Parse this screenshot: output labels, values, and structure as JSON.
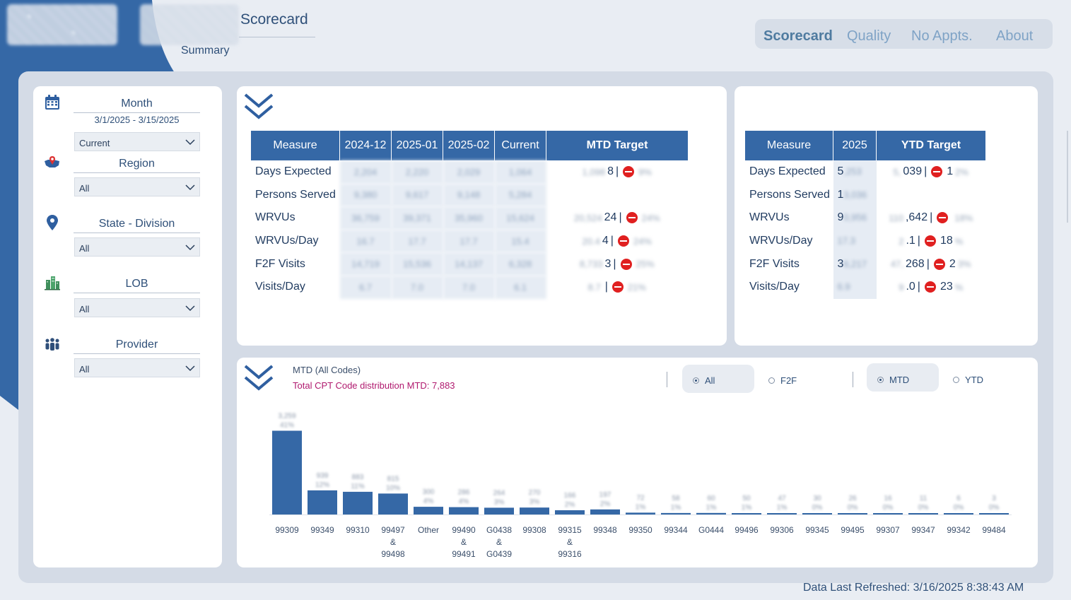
{
  "header": {
    "title": "Scorecard",
    "subtitle": "Summary"
  },
  "nav": {
    "items": [
      "Scorecard",
      "Quality",
      "No Appts.",
      "About"
    ],
    "active": "Scorecard"
  },
  "filters": {
    "month": {
      "label": "Month",
      "range": "3/1/2025 - 3/15/2025",
      "value": "Current"
    },
    "region": {
      "label": "Region",
      "value": "All"
    },
    "state": {
      "label": "State - Division",
      "value": "All"
    },
    "lob": {
      "label": "LOB",
      "value": "All"
    },
    "provider": {
      "label": "Provider",
      "value": "All"
    }
  },
  "mtd_table": {
    "headers": [
      "Measure",
      "2024-12",
      "2025-01",
      "2025-02",
      "Current",
      "MTD Target"
    ],
    "rows": [
      {
        "measure": "Days Expected",
        "values": [
          "2,204",
          "2,220",
          "2,029",
          "1,064"
        ],
        "target": "1,098",
        "target_visible": "8",
        "pct": "9%"
      },
      {
        "measure": "Persons Served",
        "values": [
          "9,380",
          "9,617",
          "9,148",
          "5,284"
        ],
        "target": "",
        "target_visible": "",
        "pct": ""
      },
      {
        "measure": "WRVUs",
        "values": [
          "36,759",
          "39,371",
          "35,960",
          "15,624"
        ],
        "target": "20,524",
        "target_visible": "24",
        "pct": "24%"
      },
      {
        "measure": "WRVUs/Day",
        "values": [
          "16.7",
          "17.7",
          "17.7",
          "15.4"
        ],
        "target": "20.4",
        "target_visible": "4",
        "pct": "24%"
      },
      {
        "measure": "F2F Visits",
        "values": [
          "14,719",
          "15,536",
          "14,137",
          "6,328"
        ],
        "target": "8,733",
        "target_visible": "3",
        "pct": "25%"
      },
      {
        "measure": "Visits/Day",
        "values": [
          "6.7",
          "7.0",
          "7.0",
          "6.1"
        ],
        "target": "8.7",
        "target_visible": "",
        "pct": "21%"
      }
    ]
  },
  "ytd_table": {
    "headers": [
      "Measure",
      "2025",
      "YTD Target"
    ],
    "rows": [
      {
        "measure": "Days Expected",
        "value_visible": "5",
        "value_blur": ",253",
        "target_blur": "5,",
        "target_visible": "039",
        "pct_visible": "1",
        "pct_blur": "2%"
      },
      {
        "measure": "Persons Served",
        "value_visible": "1",
        "value_blur": "3,036",
        "target_blur": "",
        "target_visible": "",
        "pct_visible": "",
        "pct_blur": ""
      },
      {
        "measure": "WRVUs",
        "value_visible": "9",
        "value_blur": "0,956",
        "target_blur": "110",
        "target_visible": ",642",
        "pct_visible": "",
        "pct_blur": "18%"
      },
      {
        "measure": "WRVUs/Day",
        "value_visible": "",
        "value_blur": "17.3",
        "target_blur": "2",
        "target_visible": ".1",
        "pct_visible": "18",
        "pct_blur": "%"
      },
      {
        "measure": "F2F Visits",
        "value_visible": "3",
        "value_blur": "6,217",
        "target_blur": "47,",
        "target_visible": "268",
        "pct_visible": "2",
        "pct_blur": "3%"
      },
      {
        "measure": "Visits/Day",
        "value_visible": "",
        "value_blur": "6.9",
        "target_blur": "9",
        "target_visible": ".0",
        "pct_visible": "23",
        "pct_blur": "%"
      }
    ]
  },
  "chart_panel": {
    "title": "MTD (All Codes)",
    "subtitle": "Total CPT Code distribution MTD: 7,883",
    "radio_group_1": [
      {
        "label": "All",
        "selected": true
      },
      {
        "label": "F2F",
        "selected": false
      }
    ],
    "radio_group_2": [
      {
        "label": "MTD",
        "selected": true
      },
      {
        "label": "YTD",
        "selected": false
      }
    ]
  },
  "chart_data": {
    "type": "bar",
    "title": "MTD (All Codes)",
    "categories": [
      "99309",
      "99349",
      "99310",
      "99497\n&\n99498",
      "Other",
      "99490\n&\n99491",
      "G0438\n&\nG0439",
      "99308",
      "99315\n&\n99316",
      "99348",
      "99350",
      "99344",
      "G0444",
      "99496",
      "99306",
      "99345",
      "99495",
      "99307",
      "99347",
      "99342",
      "99484"
    ],
    "values": [
      3259,
      939,
      883,
      815,
      300,
      286,
      264,
      270,
      166,
      197,
      72,
      58,
      60,
      50,
      47,
      30,
      26,
      16,
      11,
      6,
      3
    ],
    "value_labels": [
      "3,259",
      "939",
      "883",
      "815",
      "300",
      "286",
      "264",
      "270",
      "166",
      "197",
      "72",
      "58",
      "60",
      "50",
      "47",
      "30",
      "26",
      "16",
      "11",
      "6",
      "3"
    ],
    "pct_labels": [
      "41%",
      "12%",
      "11%",
      "10%",
      "4%",
      "4%",
      "3%",
      "3%",
      "2%",
      "2%",
      "1%",
      "1%",
      "1%",
      "1%",
      "1%",
      "0%",
      "0%",
      "0%",
      "0%",
      "0%",
      "0%"
    ],
    "ylim": [
      0,
      3300
    ],
    "color": "#3568a6"
  },
  "footer": {
    "refreshed": "Data Last Refreshed: 3/16/2025 8:38:43 AM"
  }
}
